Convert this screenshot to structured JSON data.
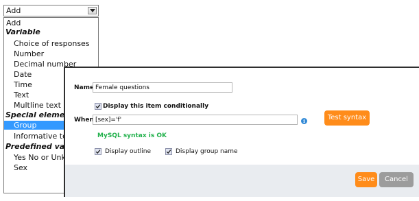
{
  "select": {
    "value": "Add",
    "options": [
      {
        "label": "Add",
        "type": "first"
      },
      {
        "label": "Variable",
        "type": "group"
      },
      {
        "label": "Choice of responses",
        "type": "option"
      },
      {
        "label": "Number",
        "type": "option"
      },
      {
        "label": "Decimal number",
        "type": "option"
      },
      {
        "label": "Date",
        "type": "option"
      },
      {
        "label": "Time",
        "type": "option"
      },
      {
        "label": "Text",
        "type": "option"
      },
      {
        "label": "Multline text",
        "type": "option"
      },
      {
        "label": "Special element",
        "type": "group"
      },
      {
        "label": "Group",
        "type": "option",
        "selected": true
      },
      {
        "label": "Informative text",
        "type": "option"
      },
      {
        "label": "Predefined value",
        "type": "group"
      },
      {
        "label": "Yes No or Unknown",
        "type": "option"
      },
      {
        "label": "Sex",
        "type": "option"
      }
    ]
  },
  "modal": {
    "name_label": "Name",
    "name_value": "Female questions",
    "display_conditionally_label": "Display this item conditionally",
    "display_conditionally_checked": true,
    "when_label": "When",
    "when_value": "[sex]='f'",
    "test_syntax_label": "Test syntax",
    "syntax_status": "MySQL syntax is OK",
    "display_outline_label": "Display outline",
    "display_outline_checked": true,
    "display_group_name_label": "Display group name",
    "display_group_name_checked": true,
    "save_label": "Save",
    "cancel_label": "Cancel"
  },
  "colors": {
    "accent_orange": "#ff8c1a",
    "selection_blue": "#3399ff",
    "ok_green": "#22b14c",
    "info_blue": "#2f88d6"
  }
}
